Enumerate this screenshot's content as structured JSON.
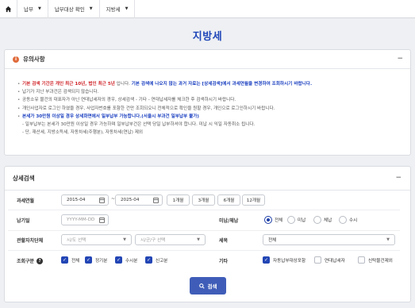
{
  "nav": {
    "home_icon": "home-icon",
    "items": [
      {
        "label": "납부"
      },
      {
        "label": "납부대상 확인"
      },
      {
        "label": "지방세"
      }
    ]
  },
  "page": {
    "title": "지방세"
  },
  "notice": {
    "title": "유의사항",
    "line1_red": "기본 검색 기간은 개인 최근 10년, 법인 최근 5년",
    "line1_mid": " 입니다. ",
    "line1_blue": "기본 검색에 나오지 않는 과거 자료는 [상세검색]에서 과세연월을 변경하여 조회하시기 바랍니다.",
    "line2": "납기가 지난 부과건은 검색되지 않습니다.",
    "line3": "공동소유 물건의 대표자가 아닌 연대납세자의 경우, 상세검색 - 기타 - 연대납세자를 체크한 후 검색하시기 바랍니다.",
    "line4": "개인사업자로 로그인 하였을 경우, 사업자번호를 포함한 건만 조회되오니 전체적으로 확인을 원할 경우, 개인으로 로그인하시기 바랍니다.",
    "line5_blue": "본세가 30만원 이상일 경우 상세화면에서 일부납부 가능합니다.(서울시 부과건 일부납부 불가)",
    "sub1": "- 일부납부는 본세가 30만원 이상일 경우 가능하며 일부납부건은 선택 당일 납부하셔야 합니다. 미납 시 익일 자동취소 됩니다.",
    "sub2": "- 단, 재산세, 지방소득세, 자동차세(주행분), 자동차세(연납) 제외"
  },
  "search": {
    "title": "상세검색",
    "period_label": "과세연월",
    "date_from": "2015-04",
    "date_to": "2025-04",
    "tilde": "~",
    "period_buttons": [
      "1개월",
      "3개월",
      "6개월",
      "12개월"
    ],
    "due_label": "납기일",
    "due_placeholder": "YYYY-MM-DD",
    "paid_label": "미납/체납",
    "paid_options": [
      {
        "label": "전체",
        "selected": true
      },
      {
        "label": "미납",
        "selected": false
      },
      {
        "label": "체납",
        "selected": false
      },
      {
        "label": "수시",
        "selected": false
      }
    ],
    "region_label": "관할자치단체",
    "sido_placeholder": "시/도 선택",
    "sigungu_placeholder": "시/군/구 선택",
    "tax_label": "세목",
    "tax_value": "전체",
    "query_label": "조회구분",
    "query_options": [
      {
        "label": "전체",
        "checked": true
      },
      {
        "label": "정기분",
        "checked": true
      },
      {
        "label": "수시분",
        "checked": true
      },
      {
        "label": "신고분",
        "checked": true
      }
    ],
    "etc_label": "기타",
    "etc_options": [
      {
        "label": "자동납부대상포함",
        "checked": true
      },
      {
        "label": "연대납세자",
        "checked": false
      },
      {
        "label": "신탁물건제외",
        "checked": false
      }
    ],
    "search_button": "검색"
  },
  "colors": {
    "accent": "#1f46b8",
    "primary_button": "#3f5db8",
    "warning": "#d0262b"
  }
}
